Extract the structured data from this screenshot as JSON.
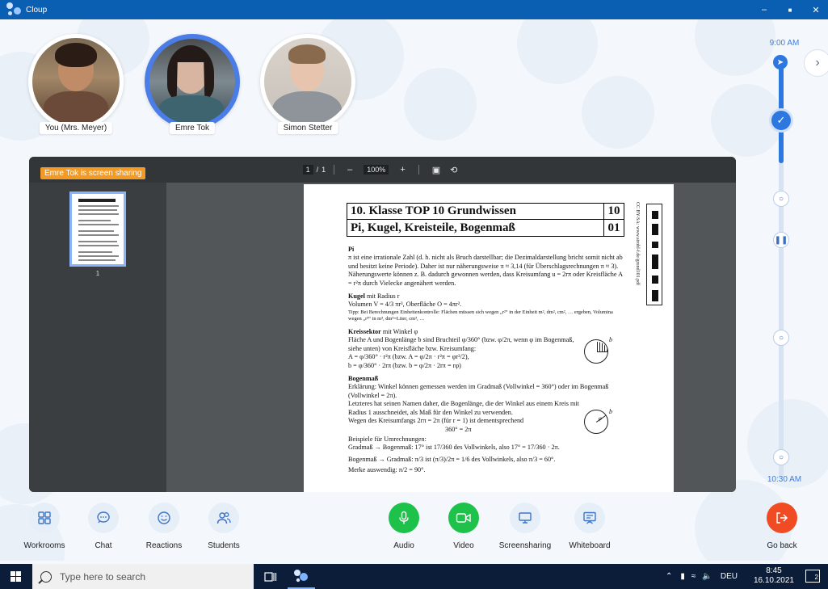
{
  "window": {
    "title": "Cloup",
    "controls": {
      "minimize": "–",
      "maximize": "■",
      "close": "✕"
    }
  },
  "participants": [
    {
      "name": "You (Mrs. Meyer)",
      "active": false
    },
    {
      "name": "Emre Tok",
      "active": true
    },
    {
      "name": "Simon Stetter",
      "active": false
    }
  ],
  "timeline": {
    "start": "9:00 AM",
    "end": "10:30 AM"
  },
  "screenshare": {
    "badge": "Emre Tok is screen sharing",
    "page_current": "1",
    "page_sep": "/",
    "page_total": "1",
    "zoom": "100%",
    "zoom_out": "–",
    "zoom_in": "+",
    "thumb_number": "1"
  },
  "document": {
    "title_row1": "10. Klasse TOP 10 Grundwissen",
    "title_num1": "10",
    "title_row2": "Pi, Kugel, Kreisteile, Bogenmaß",
    "title_num2": "01",
    "side_text": "CC BY-SA: www.strobl-f.de/grund101.pdf",
    "pi_heading": "Pi",
    "pi_text": "π ist eine irrationale Zahl (d. h. nicht als Bruch darstellbar; die Dezimaldarstellung bricht somit nicht ab und besitzt keine Periode). Daher ist nur näherungsweise π ≈ 3,14 (für Überschlagsrechnungen π ≈ 3). Näherungswerte können z. B. dadurch gewonnen werden, dass Kreisumfang u = 2rπ oder Kreisfläche A = r²π durch Vielecke angenähert werden.",
    "kugel_heading": "Kugel",
    "kugel_suffix": " mit Radius r",
    "kugel_text": "Volumen V = 4/3 πr³, Oberfläche O = 4πr².",
    "kugel_tip": "Tipp: Bei Berechnungen Einheitenkontrolle: Flächen müssen sich wegen „r²“ in der Einheit m², dm², cm², … ergeben, Volumina wegen „r³“ in m³, dm³=Liter, cm³, …",
    "sektor_heading": "Kreissektor",
    "sektor_suffix": " mit Winkel φ",
    "sektor_text1": "Fläche A und Bogenlänge b sind Bruchteil φ/360° (bzw. φ/2π, wenn φ im Bogenmaß, siehe unten) von Kreisfläche bzw. Kreisumfang:",
    "sektor_text2": "A = φ/360° · r²π (bzw. A = φ/2π · r²π = φr²/2),",
    "sektor_text3": "b = φ/360° · 2rπ (bzw. b = φ/2π · 2rπ = rφ)",
    "bogen_heading": "Bogenmaß",
    "bogen_text1": "Erklärung: Winkel können gemessen werden im Gradmaß (Vollwinkel = 360°) oder im Bogenmaß (Vollwinkel = 2π).",
    "bogen_text2": "Letzteres hat seinen Namen daher, die Bogenlänge, die der Winkel aus einem Kreis mit Radius 1 ausschneidet, als Maß für den Winkel zu verwenden.",
    "bogen_text3": "Wegen des Kreisumfangs 2rπ = 2π (für r = 1) ist dementsprechend",
    "bogen_eq": "360° = 2π",
    "beispiele": "Beispiele für Umrechnungen:",
    "gradmass": "Gradmaß → Bogenmaß: 17° ist 17/360 des Vollwinkels, also 17° = 17/360 · 2π.",
    "bogenmass": "Bogenmaß → Gradmaß: π/3 ist (π/3)/2π = 1/6 des Vollwinkels, also π/3 = 60°.",
    "merke": "Merke auswendig: π/2 = 90°.",
    "fig_label_b": "b",
    "fig_label_phi": "φ"
  },
  "controls": [
    {
      "id": "workrooms",
      "label": "Workrooms",
      "icon": "grid-icon"
    },
    {
      "id": "chat",
      "label": "Chat",
      "icon": "chat-icon"
    },
    {
      "id": "reactions",
      "label": "Reactions",
      "icon": "smiley-icon"
    },
    {
      "id": "students",
      "label": "Students",
      "icon": "people-icon"
    },
    {
      "id": "audio",
      "label": "Audio",
      "icon": "microphone-icon"
    },
    {
      "id": "video",
      "label": "Video",
      "icon": "camera-icon"
    },
    {
      "id": "screensharing",
      "label": "Screensharing",
      "icon": "monitor-icon"
    },
    {
      "id": "whiteboard",
      "label": "Whiteboard",
      "icon": "whiteboard-icon"
    },
    {
      "id": "goback",
      "label": "Go back",
      "icon": "exit-icon"
    }
  ],
  "taskbar": {
    "search_placeholder": "Type here to search",
    "language": "DEU",
    "time": "8:45",
    "date": "16.10.2021",
    "notifications": "2"
  },
  "colors": {
    "accent": "#2d78e0",
    "titlebar": "#0a5fb3",
    "badge": "#f39a24",
    "green": "#1ec24a",
    "red": "#f04b23",
    "taskbar": "#0b1d38"
  }
}
